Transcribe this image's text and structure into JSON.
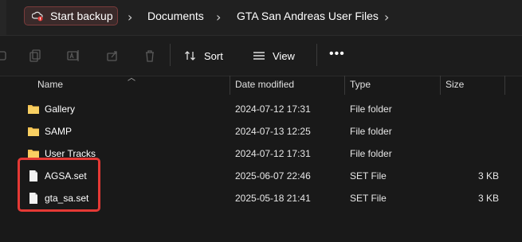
{
  "address_bar": {
    "backup_button": "Start backup",
    "breadcrumbs": [
      "Documents",
      "GTA San Andreas User Files"
    ],
    "separator": "›"
  },
  "toolbar": {
    "sort_label": "Sort",
    "view_label": "View",
    "more_label": "•••"
  },
  "columns": {
    "name": "Name",
    "date_modified": "Date modified",
    "type": "Type",
    "size": "Size"
  },
  "files": [
    {
      "name": "Gallery",
      "date": "2024-07-12 17:31",
      "type": "File folder",
      "size": "",
      "icon": "folder-icon"
    },
    {
      "name": "SAMP",
      "date": "2024-07-13 12:25",
      "type": "File folder",
      "size": "",
      "icon": "folder-icon"
    },
    {
      "name": "User Tracks",
      "date": "2024-07-12 17:31",
      "type": "File folder",
      "size": "",
      "icon": "folder-icon"
    },
    {
      "name": "AGSA.set",
      "date": "2025-06-07 22:46",
      "type": "SET File",
      "size": "3 KB",
      "icon": "file-icon"
    },
    {
      "name": "gta_sa.set",
      "date": "2025-05-18 21:41",
      "type": "SET File",
      "size": "3 KB",
      "icon": "file-icon"
    }
  ],
  "colors": {
    "background": "#191919",
    "folder": "#f4c150",
    "highlight": "#e53935"
  }
}
